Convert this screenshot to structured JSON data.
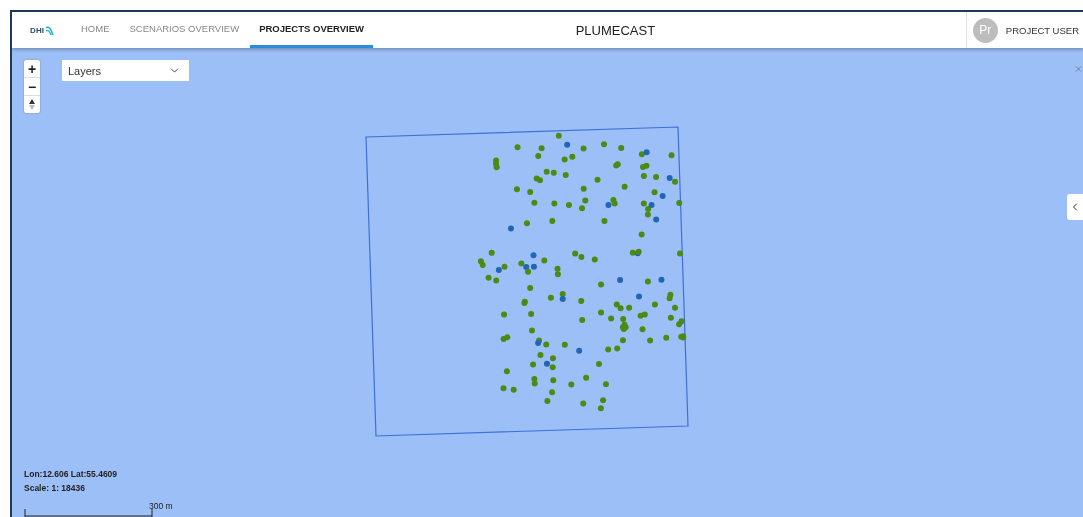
{
  "header": {
    "logo": "DHI",
    "title": "PLUMECAST",
    "user": {
      "initials": "Pr",
      "name": "PROJECT USER"
    }
  },
  "nav": [
    {
      "label": "HOME",
      "selected": false
    },
    {
      "label": "SCENARIOS OVERVIEW",
      "selected": false
    },
    {
      "label": "PROJECTS OVERVIEW",
      "selected": true
    }
  ],
  "map": {
    "zoom_in": "+",
    "zoom_out": "−",
    "layers": {
      "label": "Layers"
    },
    "coordinates": "Lon:12.606 Lat:55.4609",
    "scale": "Scale: 1: 18436",
    "scale_bar": "300 m"
  }
}
